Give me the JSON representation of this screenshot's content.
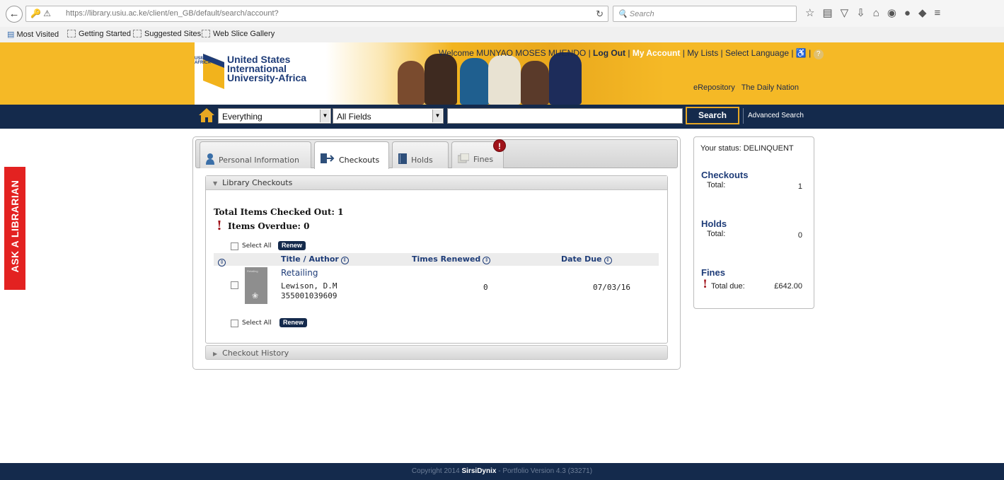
{
  "browser": {
    "url": "https://library.usiu.ac.ke/client/en_GB/default/search/account?",
    "search_placeholder": "Search",
    "bookmarks": [
      "Most Visited",
      "Getting Started",
      "Suggested Sites",
      "Web Slice Gallery"
    ]
  },
  "header": {
    "logo_badge": "USIU AFRICA",
    "logo_line1": "United States",
    "logo_line2": "International",
    "logo_line3": "University-Africa",
    "welcome": "Welcome MUNYAO MOSES MUENDO",
    "logout": "Log Out",
    "my_account": "My Account",
    "my_lists": "My Lists",
    "select_language": "Select Language",
    "link1": "eRepository",
    "link2": "The Daily Nation"
  },
  "search": {
    "scope": "Everything",
    "field": "All Fields",
    "button": "Search",
    "advanced": "Advanced Search"
  },
  "side_tab": "ASK A LIBRARIAN",
  "tabs": [
    "Personal Information",
    "Checkouts",
    "Holds",
    "Fines"
  ],
  "checkouts": {
    "section_title": "Library Checkouts",
    "total_label": "Total Items Checked Out: 1",
    "overdue_label": "Items Overdue: 0",
    "select_all": "Select All",
    "renew": "Renew",
    "columns": [
      "Title / Author",
      "Times Renewed",
      "Date Due"
    ],
    "items": [
      {
        "cover_text": "Retailing",
        "title": "Retailing",
        "author": "Lewison, D.M",
        "barcode": "355001039609",
        "times_renewed": "0",
        "date_due": "07/03/16"
      }
    ],
    "history_title": "Checkout History"
  },
  "status": {
    "your_status": "Your status: DELINQUENT",
    "checkouts_heading": "Checkouts",
    "checkouts_total_label": "Total:",
    "checkouts_total": "1",
    "holds_heading": "Holds",
    "holds_total_label": "Total:",
    "holds_total": "0",
    "fines_heading": "Fines",
    "fines_total_label": "Total due:",
    "fines_total": "£642.00"
  },
  "footer": {
    "prefix": "Copyright 2014",
    "brand": "SirsiDynix",
    "suffix": "- Portfolio Version 4.3 (33271)"
  },
  "colors": {
    "navy": "#142a4c",
    "gold": "#f5b926",
    "alert_red": "#a0131a",
    "ask_red": "#e32221"
  }
}
